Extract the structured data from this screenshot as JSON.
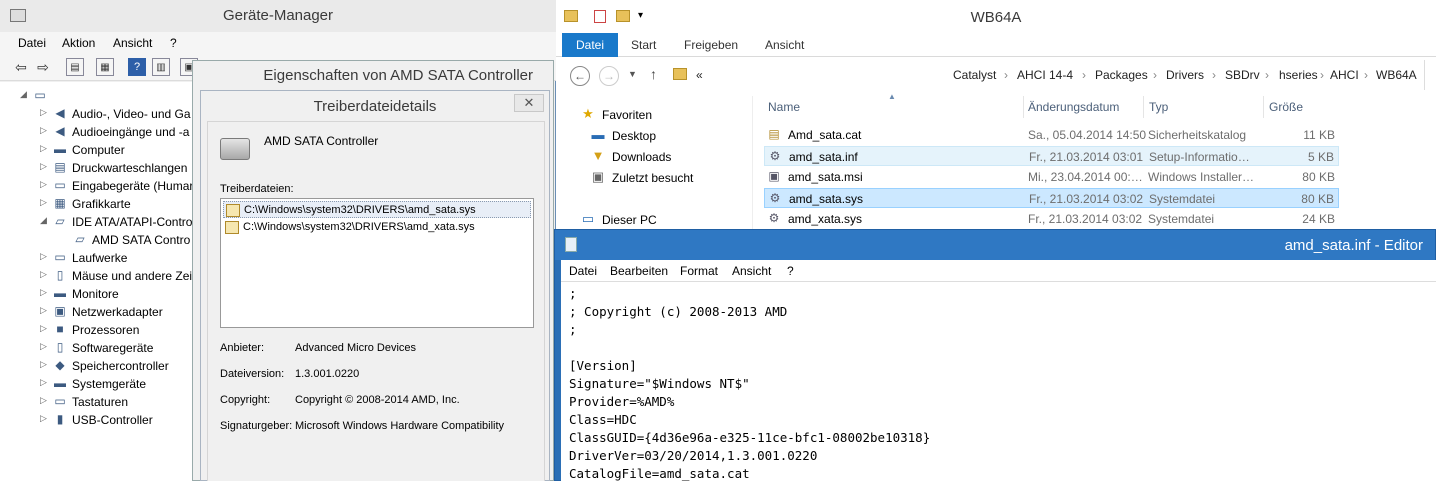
{
  "device_manager": {
    "title": "Geräte-Manager",
    "menu": [
      "Datei",
      "Aktion",
      "Ansicht",
      "?"
    ],
    "tree": [
      {
        "label": "Audio-, Video- und Ga",
        "icon": "speaker-icon",
        "expander": "▷"
      },
      {
        "label": "Audioeingänge und -a",
        "icon": "speaker-icon",
        "expander": "▷"
      },
      {
        "label": "Computer",
        "icon": "monitor-icon",
        "expander": "▷"
      },
      {
        "label": "Druckwarteschlangen",
        "icon": "printer-icon",
        "expander": "▷"
      },
      {
        "label": "Eingabegeräte (Humar",
        "icon": "keyboard-icon",
        "expander": "▷"
      },
      {
        "label": "Grafikkarte",
        "icon": "display-adapter-icon",
        "expander": "▷"
      },
      {
        "label": "IDE ATA/ATAPI-Contro",
        "icon": "controller-icon",
        "expander": "◢"
      },
      {
        "label": "AMD SATA Contro",
        "icon": "controller-icon",
        "expander": ""
      },
      {
        "label": "Laufwerke",
        "icon": "drive-icon",
        "expander": "▷"
      },
      {
        "label": "Mäuse und andere Zei",
        "icon": "mouse-icon",
        "expander": "▷"
      },
      {
        "label": "Monitore",
        "icon": "monitor-icon",
        "expander": "▷"
      },
      {
        "label": "Netzwerkadapter",
        "icon": "network-icon",
        "expander": "▷"
      },
      {
        "label": "Prozessoren",
        "icon": "processor-icon",
        "expander": "▷"
      },
      {
        "label": "Softwaregeräte",
        "icon": "software-device-icon",
        "expander": "▷"
      },
      {
        "label": "Speichercontroller",
        "icon": "storage-controller-icon",
        "expander": "▷"
      },
      {
        "label": "Systemgeräte",
        "icon": "monitor-icon",
        "expander": "▷"
      },
      {
        "label": "Tastaturen",
        "icon": "keyboard-icon",
        "expander": "▷"
      },
      {
        "label": "USB-Controller",
        "icon": "usb-icon",
        "expander": "▷"
      }
    ]
  },
  "properties_dialog": {
    "title": "Eigenschaften von AMD SATA Controller"
  },
  "driver_details": {
    "title": "Treiberdateidetails",
    "close": "✕",
    "device_name": "AMD SATA Controller",
    "files_label": "Treiberdateien:",
    "files": [
      "C:\\Windows\\system32\\DRIVERS\\amd_sata.sys",
      "C:\\Windows\\system32\\DRIVERS\\amd_xata.sys"
    ],
    "info": [
      {
        "label": "Anbieter:",
        "value": "Advanced Micro Devices"
      },
      {
        "label": "Dateiversion:",
        "value": "1.3.001.0220"
      },
      {
        "label": "Copyright:",
        "value": "Copyright © 2008-2014 AMD, Inc."
      },
      {
        "label": "Signaturgeber:",
        "value": "Microsoft Windows Hardware Compatibility"
      }
    ]
  },
  "explorer": {
    "title": "WB64A",
    "ribbon_tabs": [
      "Datei",
      "Start",
      "Freigeben",
      "Ansicht"
    ],
    "overflow": "«",
    "breadcrumb": [
      "Catalyst",
      "AHCI 14-4",
      "Packages",
      "Drivers",
      "SBDrv",
      "hseries",
      "AHCI",
      "WB64A"
    ],
    "nav": [
      {
        "label": "Favoriten",
        "icon": "star-icon"
      },
      {
        "label": "Desktop",
        "icon": "desktop-icon"
      },
      {
        "label": "Downloads",
        "icon": "downloads-icon"
      },
      {
        "label": "Zuletzt besucht",
        "icon": "recent-icon"
      },
      {
        "label": "Dieser PC",
        "icon": "pc-icon"
      }
    ],
    "columns": {
      "name": "Name",
      "date": "Änderungsdatum",
      "type": "Typ",
      "size": "Größe"
    },
    "files": [
      {
        "name": "Amd_sata.cat",
        "date": "Sa., 05.04.2014 14:50",
        "type": "Sicherheitskatalog",
        "size": "11 KB",
        "icon": "catalog-file-icon"
      },
      {
        "name": "amd_sata.inf",
        "date": "Fr., 21.03.2014 03:01",
        "type": "Setup-Informatio…",
        "size": "5 KB",
        "icon": "inf-file-icon"
      },
      {
        "name": "amd_sata.msi",
        "date": "Mi., 23.04.2014 00:…",
        "type": "Windows Installer…",
        "size": "80 KB",
        "icon": "msi-file-icon"
      },
      {
        "name": "amd_sata.sys",
        "date": "Fr., 21.03.2014 03:02",
        "type": "Systemdatei",
        "size": "80 KB",
        "icon": "sys-file-icon"
      },
      {
        "name": "amd_xata.sys",
        "date": "Fr., 21.03.2014 03:02",
        "type": "Systemdatei",
        "size": "24 KB",
        "icon": "sys-file-icon"
      }
    ]
  },
  "notepad": {
    "title": "amd_sata.inf - Editor",
    "menu": [
      "Datei",
      "Bearbeiten",
      "Format",
      "Ansicht",
      "?"
    ],
    "lines": [
      ";",
      "; Copyright (c) 2008-2013 AMD",
      ";",
      "",
      "[Version]",
      "Signature=\"$Windows NT$\"",
      "Provider=%AMD%",
      "Class=HDC",
      "ClassGUID={4d36e96a-e325-11ce-bfc1-08002be10318}",
      "DriverVer=03/20/2014,1.3.001.0220",
      "CatalogFile=amd_sata.cat"
    ]
  }
}
